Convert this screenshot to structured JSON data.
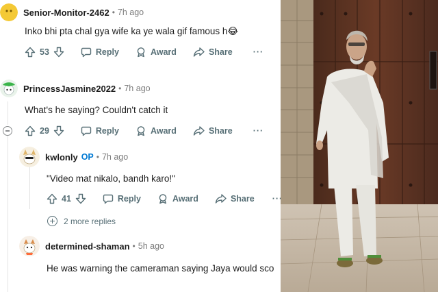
{
  "comments": [
    {
      "username": "Senior-Monitor-2462",
      "separator": "•",
      "timestamp": "7h ago",
      "body": "Inko bhi pta chal gya wife ka ye wala gif famous h😂",
      "votes": "53",
      "reply_label": "Reply",
      "award_label": "Award",
      "share_label": "Share",
      "more_label": "···"
    },
    {
      "username": "PrincessJasmine2022",
      "separator": "•",
      "timestamp": "7h ago",
      "body": "What's he saying? Couldn't catch it",
      "votes": "29",
      "reply_label": "Reply",
      "award_label": "Award",
      "share_label": "Share",
      "more_label": "···"
    },
    {
      "username": "kwlonly",
      "op_badge": "OP",
      "separator": "•",
      "timestamp": "7h ago",
      "body": "\"Video mat nikalo, bandh karo!\"",
      "votes": "41",
      "reply_label": "Reply",
      "award_label": "Award",
      "share_label": "Share",
      "more_label": "···"
    },
    {
      "username": "determined-shaman",
      "separator": "•",
      "timestamp": "5h ago",
      "body": "He was warning the cameraman saying Jaya would sco"
    }
  ],
  "more_replies_label": "2 more replies",
  "colors": {
    "action_gray": "#576f76",
    "op_blue": "#0079d3",
    "thread_line": "#e2e2e2"
  },
  "icons": [
    "upvote-icon",
    "downvote-icon",
    "reply-icon",
    "award-icon",
    "share-icon",
    "overflow-menu-icon",
    "collapse-icon",
    "expand-icon"
  ]
}
